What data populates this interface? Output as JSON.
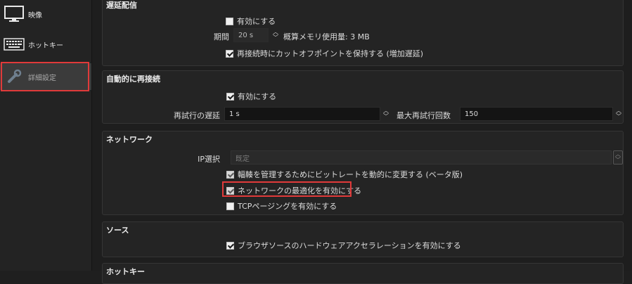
{
  "sidebar": {
    "items": [
      {
        "label": "映像",
        "icon": "monitor-icon"
      },
      {
        "label": "ホットキー",
        "icon": "keyboard-icon"
      },
      {
        "label": "詳細設定",
        "icon": "wrench-icon"
      }
    ]
  },
  "delay": {
    "title": "遅延配信",
    "enable_label": "有効にする",
    "duration_label": "期間",
    "duration_value": "20 s",
    "memory_text": "概算メモリ使用量: 3 MB",
    "preserve_label": "再接続時にカットオフポイントを保持する (増加遅延)"
  },
  "reconnect": {
    "title": "自動的に再接続",
    "enable_label": "有効にする",
    "retry_delay_label": "再試行の遅延",
    "retry_delay_value": "1 s",
    "max_retries_label": "最大再試行回数",
    "max_retries_value": "150"
  },
  "network": {
    "title": "ネットワーク",
    "ip_label": "IP選択",
    "ip_value": "既定",
    "dynamic_bitrate_label": "輻輳を管理するためにビットレートを動的に変更する (ベータ版)",
    "network_opt_label": "ネットワークの最適化を有効にする",
    "tcp_pacing_label": "TCPページングを有効にする"
  },
  "sources": {
    "title": "ソース",
    "browser_hw_label": "ブラウザソースのハードウェアアクセラレーションを有効にする"
  },
  "hotkeys": {
    "title": "ホットキー"
  },
  "colors": {
    "highlight": "#e03a3a",
    "background": "#1e1e1e",
    "group_background": "#242424"
  }
}
